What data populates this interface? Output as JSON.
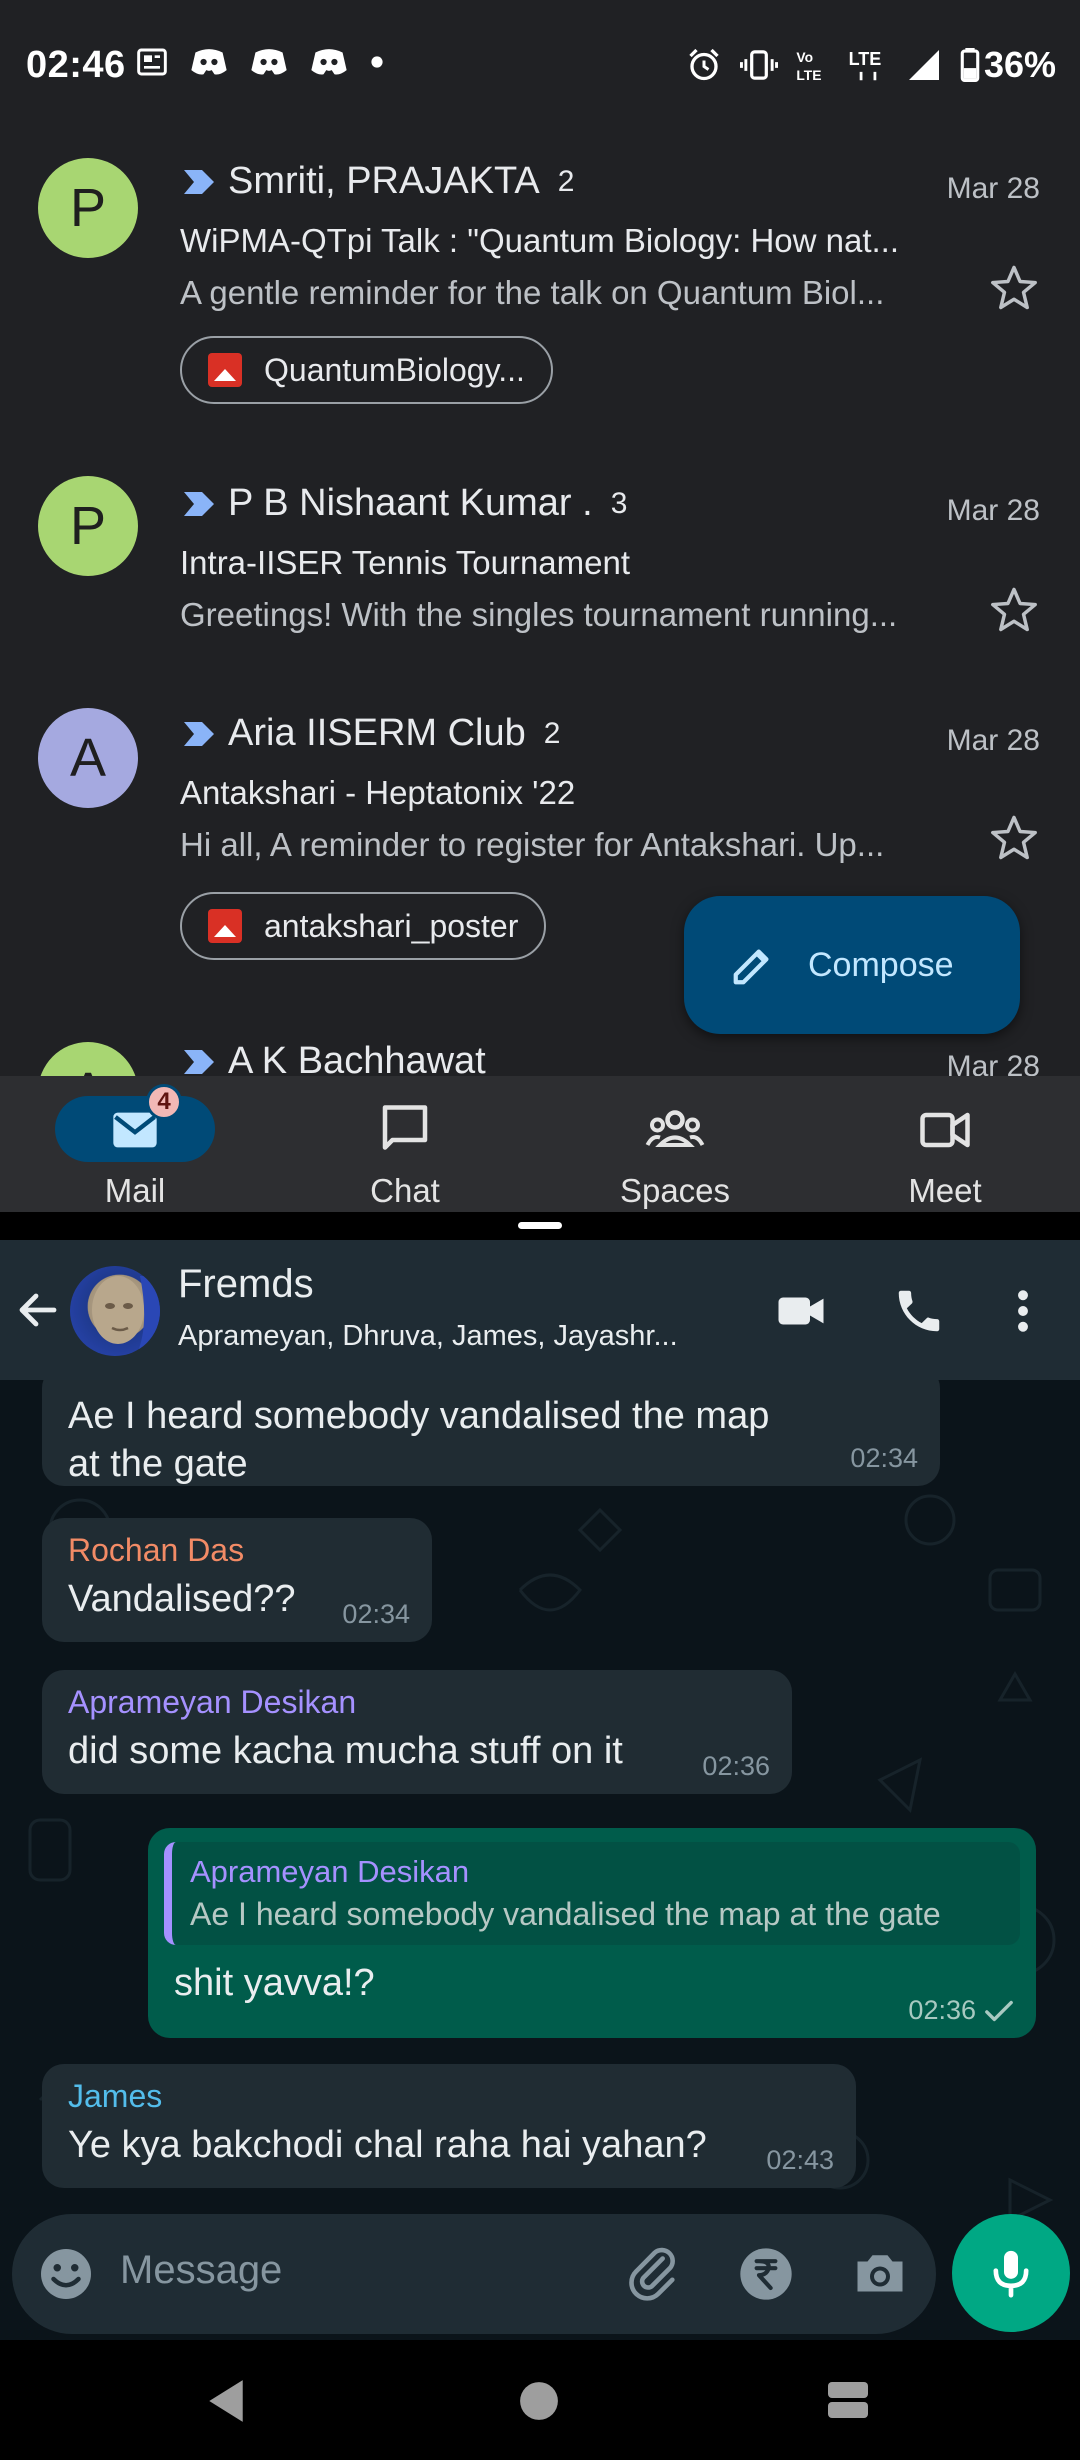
{
  "status_bar": {
    "time": "02:46",
    "battery": "36%",
    "network": "LTE",
    "left_icons": [
      "news-icon",
      "discord-icon",
      "discord-icon",
      "discord-icon",
      "dot-icon"
    ],
    "right_icons": [
      "alarm-icon",
      "vibrate-icon",
      "volte-icon",
      "lte-icon",
      "signal-icon",
      "battery-icon"
    ]
  },
  "gmail": {
    "emails": [
      {
        "avatar_letter": "P",
        "avatar_color": "#a8d672",
        "sender": "Smriti, PRAJAKTA",
        "count": "2",
        "date": "Mar 28",
        "subject": "WiPMA-QTpi Talk : \"Quantum Biology: How nat...",
        "snippet": "A gentle reminder for the talk on Quantum Biol...",
        "attachment": "QuantumBiology..."
      },
      {
        "avatar_letter": "P",
        "avatar_color": "#a8d672",
        "sender": "P B Nishaant Kumar .",
        "count": "3",
        "date": "Mar 28",
        "subject": "Intra-IISER Tennis Tournament",
        "snippet": "Greetings! With the singles tournament running..."
      },
      {
        "avatar_letter": "A",
        "avatar_color": "#a5a9e0",
        "sender": "Aria IISERM Club",
        "count": "2",
        "date": "Mar 28",
        "subject": "Antakshari - Heptatonix '22",
        "snippet": "Hi all, A reminder to register for Antakshari. Up...",
        "attachment": "antakshari_poster"
      },
      {
        "avatar_letter": "A",
        "avatar_color": "#a8d672",
        "sender": "A K Bachhawat",
        "count": "",
        "date": "Mar 28",
        "subject": "",
        "snippet": ""
      }
    ],
    "compose_label": "Compose",
    "nav": {
      "mail": "Mail",
      "mail_badge": "4",
      "chat": "Chat",
      "spaces": "Spaces",
      "meet": "Meet"
    },
    "accent": "#004a77"
  },
  "whatsapp": {
    "group_name": "Fremds",
    "members": "Aprameyan, Dhruva, James, Jayashr...",
    "input_placeholder": "Message",
    "messages": [
      {
        "sender": "",
        "text": "Ae I heard somebody vandalised the map at the gate",
        "time": "02:34",
        "direction": "in"
      },
      {
        "sender": "Rochan Das",
        "sender_color": "#f28b66",
        "text": "Vandalised??",
        "time": "02:34",
        "direction": "in"
      },
      {
        "sender": "Aprameyan Desikan",
        "sender_color": "#a591ff",
        "text": "did some kacha mucha stuff on it",
        "time": "02:36",
        "direction": "in"
      },
      {
        "sender": "",
        "quote_sender": "Aprameyan Desikan",
        "quote_text": "Ae I heard somebody vandalised the map at the gate",
        "text": "shit yavva!?",
        "time": "02:36",
        "direction": "out",
        "status": "sent-tick"
      },
      {
        "sender": "James",
        "sender_color": "#53bdeb",
        "text": "Ye kya bakchodi chal raha hai yahan?",
        "time": "02:43",
        "direction": "in"
      }
    ],
    "accent": "#00a884"
  }
}
